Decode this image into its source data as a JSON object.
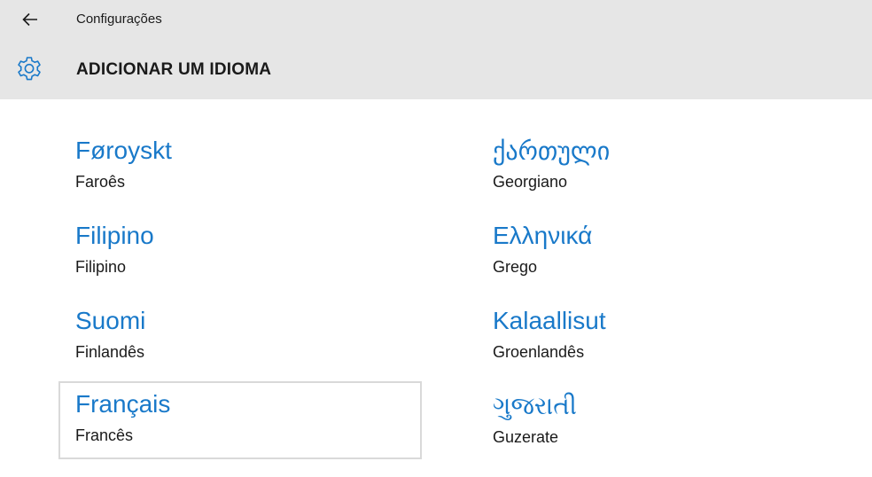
{
  "header": {
    "app_title": "Configurações",
    "page_title": "ADICIONAR UM IDIOMA"
  },
  "icons": {
    "back": "back-arrow-icon",
    "settings": "gear-icon"
  },
  "colors": {
    "accent": "#1979c9",
    "header_bg": "#e6e6e6",
    "selected_border": "#d9d9d9"
  },
  "languages": [
    {
      "native": "Føroyskt",
      "portuguese": "Faroês"
    },
    {
      "native": "Filipino",
      "portuguese": "Filipino"
    },
    {
      "native": "Suomi",
      "portuguese": "Finlandês"
    },
    {
      "native": "Français",
      "portuguese": "Francês",
      "selected": true
    },
    {
      "native": "ქართული",
      "portuguese": "Georgiano"
    },
    {
      "native": "Ελληνικά",
      "portuguese": "Grego"
    },
    {
      "native": "Kalaallisut",
      "portuguese": "Groenlandês"
    },
    {
      "native": "ગુજરાતી",
      "portuguese": "Guzerate"
    }
  ]
}
